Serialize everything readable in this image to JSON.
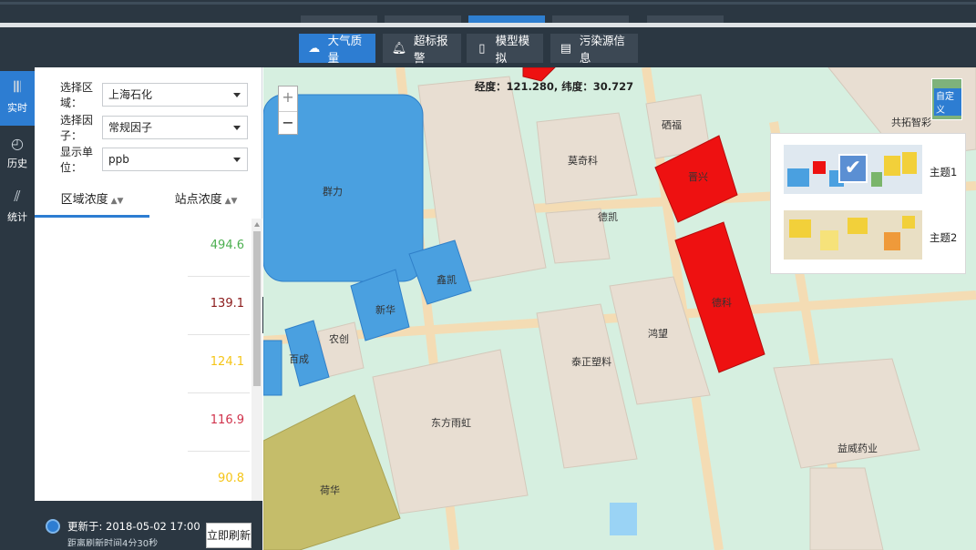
{
  "nav": {
    "items": [
      {
        "label": "大气质量",
        "icon": "cloud-icon",
        "active": true
      },
      {
        "label": "超标报警",
        "icon": "bell-icon",
        "active": false
      },
      {
        "label": "模型模拟",
        "icon": "map-icon",
        "active": false
      },
      {
        "label": "污染源信息",
        "icon": "clipboard-icon",
        "active": false
      }
    ]
  },
  "rail": {
    "items": [
      {
        "label": "实时",
        "icon": "waveform-icon",
        "active": true
      },
      {
        "label": "历史",
        "icon": "clock-icon",
        "active": false
      },
      {
        "label": "统计",
        "icon": "chart-icon",
        "active": false
      }
    ]
  },
  "filters": {
    "region": {
      "label": "选择区域：",
      "value": "上海石化"
    },
    "factor": {
      "label": "选择因子：",
      "value": "常规因子"
    },
    "unit": {
      "label": "显示单位：",
      "value": "ppb"
    }
  },
  "tabs": [
    {
      "label": "区域浓度",
      "sort": "▲▼",
      "active": true
    },
    {
      "label": "站点浓度",
      "sort": "▲▼",
      "active": false
    }
  ],
  "list": [
    {
      "value": "494.6",
      "color": "#4caf50"
    },
    {
      "value": "139.1",
      "color": "#8b1a1a"
    },
    {
      "value": "124.1",
      "color": "#f5c518"
    },
    {
      "value": "116.9",
      "color": "#d0324b"
    },
    {
      "value": "90.8",
      "color": "#f5c518"
    }
  ],
  "footer": {
    "updated": "更新于: 2018-05-02 17:00",
    "next_refresh": "距离刷新时间4分30秒",
    "refresh_button": "立即刷新"
  },
  "map": {
    "coord": "经度：121.280, 纬度：30.727",
    "zoom_in": "+",
    "zoom_out": "−",
    "theme_toggle_label": "自定义",
    "themes": [
      {
        "label": "主题1",
        "selected": true
      },
      {
        "label": "主题2",
        "selected": false
      }
    ],
    "labels": {
      "qunli": "群力",
      "xinhua": "新华",
      "xinkai": "鑫凯",
      "nongchuang": "农创",
      "baicheng": "百成",
      "huahua": "荷华",
      "dongfang": "东方雨虹",
      "taizheng": "泰正塑料",
      "hongwang": "鸿望",
      "molike": "莫奇科",
      "dekai": "德凯",
      "zhaoyang": "硒福",
      "gongtuo": "共拓智彩",
      "yiwei": "益威药业",
      "red1": "晋兴",
      "red2": "德科"
    }
  }
}
